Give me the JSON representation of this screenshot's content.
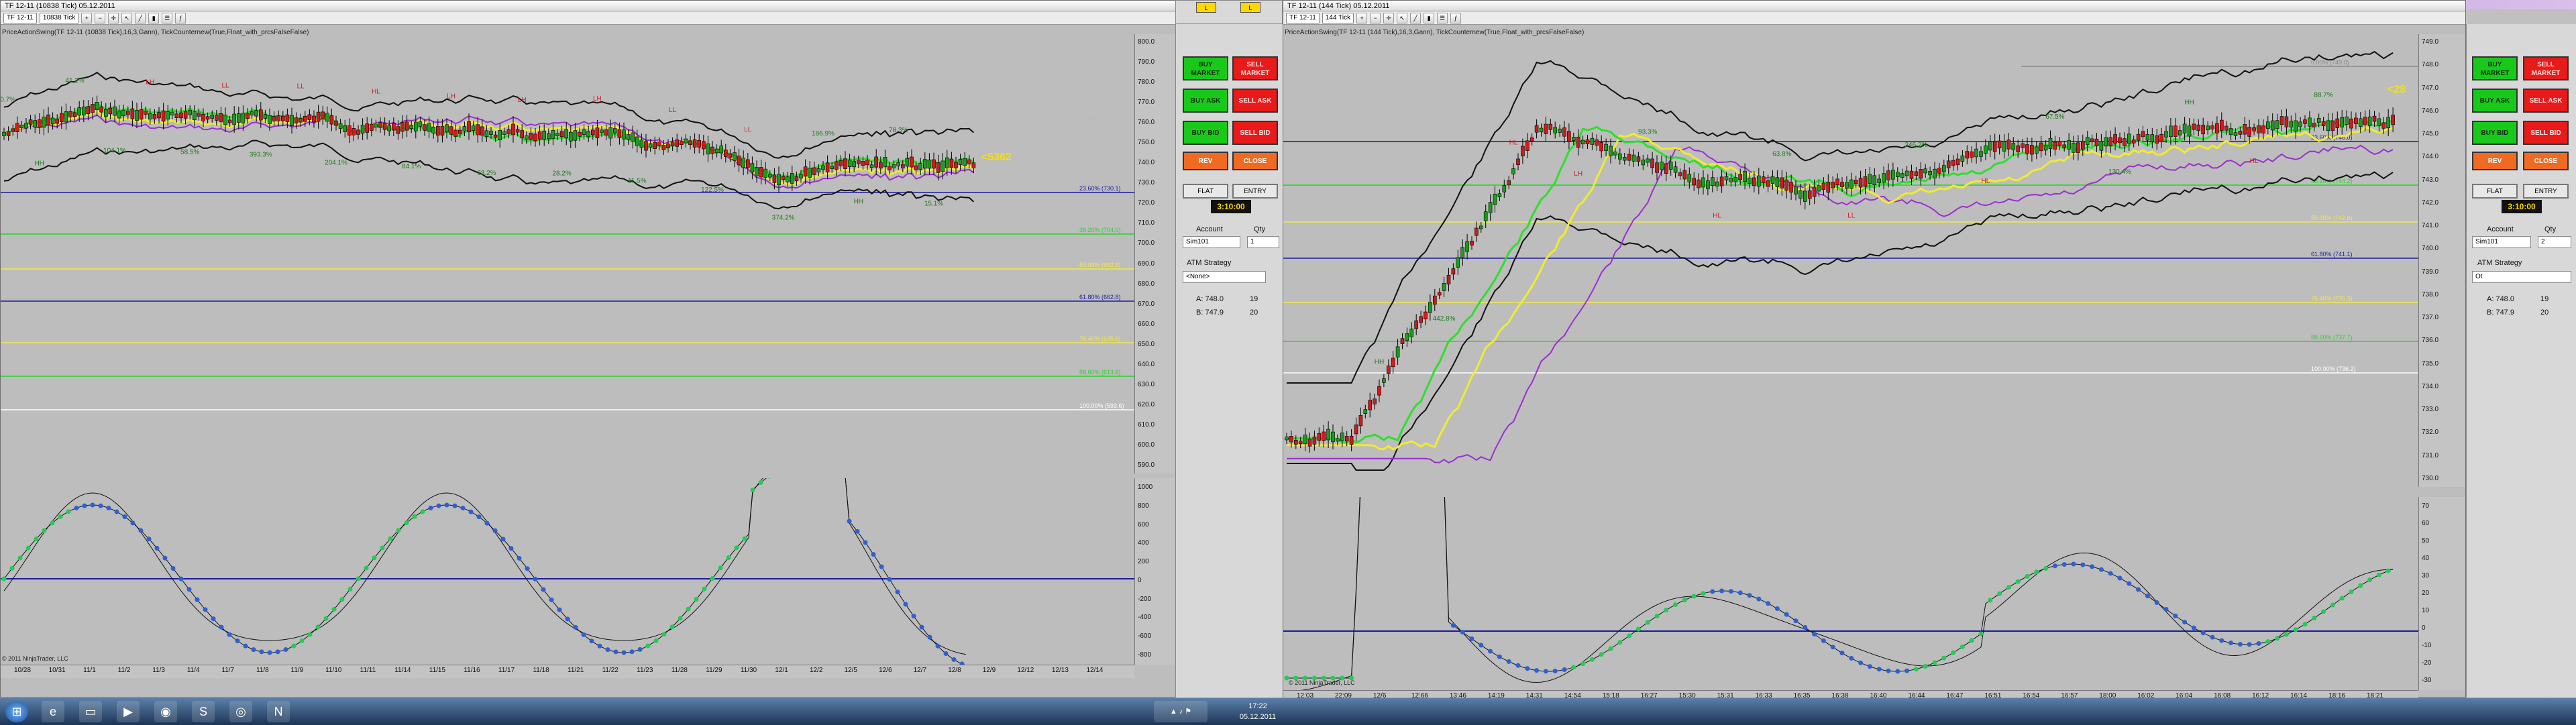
{
  "left_chart": {
    "title": "TF 12-11 (10838 Tick)  05.12.2011",
    "instrument": "TF 12-11",
    "period": "10838 Tick",
    "indicator_label": "PriceActionSwing(TF 12-11 (10838 Tick),16,3,Gann), TickCounternew(True,Float_with_prcsFalseFalse)",
    "price_labels": [
      "800.0",
      "790.0",
      "780.0",
      "770.0",
      "760.0",
      "750.0",
      "740.0",
      "730.0",
      "720.0",
      "710.0",
      "700.0",
      "690.0",
      "680.0",
      "670.0",
      "660.0",
      "650.0",
      "640.0",
      "630.0",
      "620.0",
      "610.0",
      "600.0",
      "590.0"
    ],
    "osc_labels": [
      "1000",
      "800",
      "600",
      "400",
      "200",
      "0",
      "-200",
      "-400",
      "-600",
      "-800"
    ],
    "x_labels": [
      "10/28",
      "10/31",
      "11/1",
      "11/2",
      "11/3",
      "11/4",
      "11/7",
      "11/8",
      "11/9",
      "11/10",
      "11/11",
      "11/14",
      "11/15",
      "11/16",
      "11/17",
      "11/18",
      "11/21",
      "11/22",
      "11/23",
      "11/28",
      "11/29",
      "11/30",
      "12/1",
      "12/2",
      "12/5",
      "12/6",
      "12/7",
      "12/8",
      "12/9",
      "12/12",
      "12/13",
      "12/14"
    ],
    "tick_counter": "<5362",
    "fib_labels": [
      "0.00% (772.3)",
      "23.60% (730.1)",
      "38.20% (704.0)",
      "50.00% (682.9)",
      "61.80% (662.8)",
      "76.40% (635.6)",
      "88.60% (613.8)",
      "100.00% (593.6)"
    ],
    "swing_labels": [
      "210.7%",
      "HH",
      "41.2%",
      "104.1%",
      "LH",
      "58.5%",
      "LL",
      "393.3%",
      "LL",
      "204.1%",
      "HL",
      "84.1%",
      "LH",
      "93.2%",
      "LH",
      "28.2%",
      "LH",
      "11.5%",
      "LL",
      "122.5%",
      "LL",
      "374.2%",
      "186.9%",
      "HH",
      "78.3%",
      "15.1%"
    ],
    "copyright": "© 2011 NinjaTrader, LLC"
  },
  "right_chart": {
    "title": "TF 12-11 (144 Tick)  05.12.2011",
    "instrument": "TF 12-11",
    "period": "144 Tick",
    "indicator_label": "PriceActionSwing(TF 12-11 (144 Tick),16,3,Gann), TickCounternew(True,Float_with_prcsFalseFalse)",
    "price_labels": [
      "749.0",
      "748.0",
      "747.0",
      "746.0",
      "745.0",
      "744.0",
      "743.0",
      "742.0",
      "741.0",
      "740.0",
      "739.0",
      "738.0",
      "737.0",
      "736.0",
      "735.0",
      "734.0",
      "733.0",
      "732.0",
      "731.0",
      "730.0"
    ],
    "osc_labels": [
      "70",
      "60",
      "50",
      "40",
      "30",
      "20",
      "10",
      "0",
      "-10",
      "-20",
      "-30"
    ],
    "x_labels": [
      "12:03",
      "22:09",
      "12/6",
      "12:66",
      "13:46",
      "14:19",
      "14:31",
      "14:54",
      "15:18",
      "16:27",
      "15:30",
      "15:31",
      "16:33",
      "16:35",
      "16:38",
      "16:40",
      "16:44",
      "16:47",
      "16:51",
      "16:54",
      "16:57",
      "18:00",
      "16:02",
      "16:04",
      "16:08",
      "16:12",
      "16:14",
      "18:16",
      "18:21"
    ],
    "tick_counter": "<28",
    "fib_labels": [
      "0.00% (749.0)",
      "23.60% (746.0)",
      "38.20% (744.2)",
      "50.00% (742.6)",
      "61.80% (741.1)",
      "76.40% (739.3)",
      "88.60% (737.7)",
      "100.00% (736.2)"
    ],
    "swing_labels": [
      "HH",
      "442.8%",
      "HL",
      "LH",
      "93.3%",
      "HL",
      "63.8%",
      "LL",
      "246.2%",
      "HL",
      "67.5%",
      "130.4%",
      "HH",
      "HL",
      "88.7%"
    ],
    "copyright": "© 2011 NinjaTrader, LLC"
  },
  "order_panel": {
    "buy_market": "BUY MARKET",
    "sell_market": "SELL MARKET",
    "buy_ask": "BUY ASK",
    "sell_ask": "SELL ASK",
    "buy_bid": "BUY BID",
    "sell_bid": "SELL BID",
    "rev": "REV",
    "close": "CLOSE",
    "flat": "FLAT",
    "entry": "ENTRY",
    "timer": "3:10:00",
    "account_label": "Account",
    "account_value": "Sim101",
    "qty_label": "Qty",
    "qty_left": "1",
    "qty_right": "2",
    "atm_label": "ATM Strategy",
    "atm_left": "<None>",
    "atm_right": "Ot",
    "ask_label": "A: 748.0",
    "ask_size": "19",
    "bid_label": "B: 747.9",
    "bid_size": "20"
  },
  "taskbar": {
    "time": "17:22",
    "date": "05.12.2011"
  },
  "colors": {
    "up_candle": "#1a9e1a",
    "down_candle": "#d21a1a",
    "fib_blue": "#1b1b9c",
    "fib_yellow": "#f2e94a",
    "fib_green": "#27d427",
    "ma_green": "#2ce02c",
    "ma_yellow": "#f0ec2e",
    "ma_purple": "#9b2fcf"
  }
}
